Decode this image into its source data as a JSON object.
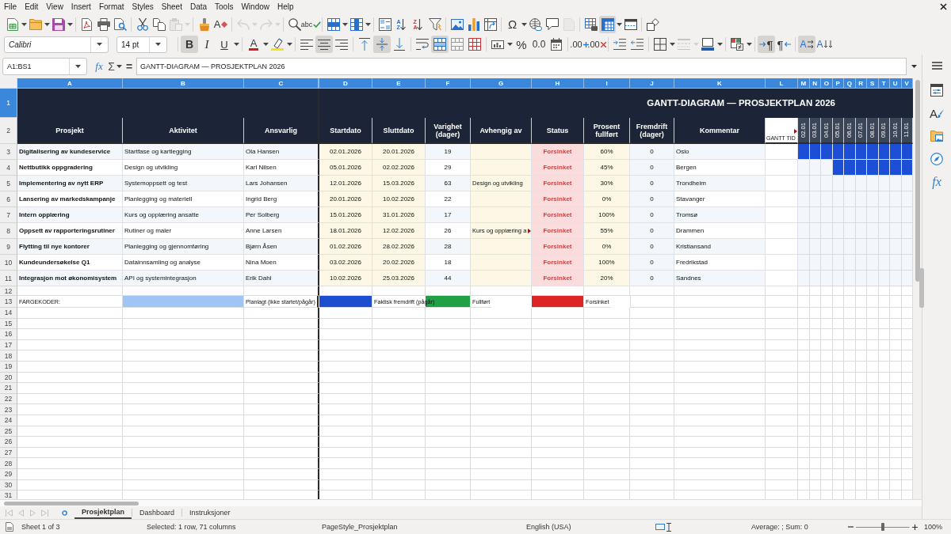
{
  "menu_bar": [
    "File",
    "Edit",
    "View",
    "Insert",
    "Format",
    "Styles",
    "Sheet",
    "Data",
    "Tools",
    "Window",
    "Help"
  ],
  "toolbar_1": {
    "groups": [
      {
        "items": [
          {
            "kind": "new",
            "dropdown": true,
            "pressed": false,
            "disabled": false
          },
          {
            "kind": "open",
            "dropdown": true,
            "pressed": false,
            "disabled": false
          },
          {
            "kind": "save",
            "dropdown": true,
            "pressed": false,
            "disabled": false
          }
        ]
      },
      {
        "items": [
          {
            "kind": "export_pdf",
            "pressed": false,
            "disabled": false
          },
          {
            "kind": "print",
            "pressed": false,
            "disabled": false
          },
          {
            "kind": "print_preview",
            "pressed": false,
            "disabled": false
          }
        ]
      },
      {
        "items": [
          {
            "kind": "cut",
            "pressed": false,
            "disabled": false
          },
          {
            "kind": "copy",
            "pressed": false,
            "disabled": false
          },
          {
            "kind": "paste",
            "dropdown": true,
            "pressed": false,
            "disabled": true
          }
        ]
      },
      {
        "items": [
          {
            "kind": "clone",
            "pressed": false,
            "disabled": false
          },
          {
            "kind": "clear_format",
            "glyph": "A",
            "pressed": false,
            "disabled": false
          }
        ]
      },
      {
        "items": [
          {
            "kind": "undo",
            "dropdown": true,
            "pressed": false,
            "disabled": true
          },
          {
            "kind": "redo",
            "dropdown": true,
            "pressed": false,
            "disabled": true
          }
        ]
      },
      {
        "items": [
          {
            "kind": "find_replace",
            "pressed": false,
            "disabled": false
          },
          {
            "kind": "spelling",
            "glyph": "abc",
            "pressed": false,
            "disabled": false
          }
        ]
      },
      {
        "items": [
          {
            "kind": "row",
            "dropdown": true,
            "pressed": false,
            "disabled": false
          },
          {
            "kind": "column",
            "dropdown": true,
            "pressed": false,
            "disabled": false
          }
        ]
      },
      {
        "items": [
          {
            "kind": "sort",
            "pressed": false,
            "disabled": false
          },
          {
            "kind": "sort_ascending",
            "glyph": "AZ",
            "pressed": false,
            "disabled": false
          },
          {
            "kind": "sort_descending",
            "glyph": "ZA",
            "pressed": false,
            "disabled": false
          },
          {
            "kind": "autofilter",
            "pressed": false,
            "disabled": false
          }
        ]
      },
      {
        "items": [
          {
            "kind": "image",
            "pressed": false,
            "disabled": false
          },
          {
            "kind": "chart",
            "pressed": false,
            "disabled": false
          },
          {
            "kind": "pivot_table",
            "pressed": false,
            "disabled": false
          }
        ]
      },
      {
        "items": [
          {
            "kind": "special_character",
            "glyph": "Ω",
            "dropdown": true,
            "pressed": false,
            "disabled": false
          },
          {
            "kind": "hyperlink",
            "pressed": false,
            "disabled": false
          },
          {
            "kind": "comment",
            "pressed": false,
            "disabled": false
          },
          {
            "kind": "header_footer",
            "pressed": false,
            "disabled": true
          }
        ]
      },
      {
        "items": [
          {
            "kind": "print_area",
            "pressed": false,
            "disabled": false
          },
          {
            "kind": "freeze",
            "dropdown": true,
            "pressed": true,
            "disabled": false
          },
          {
            "kind": "split_window",
            "pressed": false,
            "disabled": false
          }
        ]
      },
      {
        "items": [
          {
            "kind": "draw_functions",
            "pressed": false,
            "disabled": false
          }
        ]
      }
    ]
  },
  "toolbar_2": {
    "font_name": "Calibri",
    "font_size": "14 pt",
    "groups": [
      {
        "items": [
          {
            "kind": "bold",
            "glyph": "B",
            "pressed": true,
            "disabled": false
          },
          {
            "kind": "italic",
            "glyph": "I",
            "pressed": false,
            "disabled": false
          },
          {
            "kind": "underline",
            "glyph": "U",
            "dropdown": true,
            "pressed": false,
            "disabled": false
          }
        ]
      },
      {
        "items": [
          {
            "kind": "font_color",
            "glyph": "A",
            "dropdown": true,
            "pressed": false,
            "disabled": false
          },
          {
            "kind": "highlight",
            "dropdown": true,
            "pressed": false,
            "disabled": false
          }
        ]
      },
      {
        "items": [
          {
            "kind": "align_left",
            "pressed": false,
            "disabled": false
          },
          {
            "kind": "align_center",
            "pressed": true,
            "disabled": false
          },
          {
            "kind": "align_right",
            "pressed": false,
            "disabled": false
          }
        ]
      },
      {
        "items": [
          {
            "kind": "align_top",
            "pressed": false,
            "disabled": false
          },
          {
            "kind": "align_middle",
            "pressed": true,
            "disabled": false
          },
          {
            "kind": "align_bottom",
            "pressed": false,
            "disabled": false
          }
        ]
      },
      {
        "items": [
          {
            "kind": "wrap_text",
            "pressed": false,
            "disabled": false
          },
          {
            "kind": "merge_center",
            "pressed": true,
            "disabled": false
          },
          {
            "kind": "merge",
            "pressed": false,
            "disabled": false
          },
          {
            "kind": "unmerge",
            "pressed": false,
            "disabled": false
          }
        ]
      },
      {
        "items": [
          {
            "kind": "currency",
            "dropdown": true,
            "pressed": false,
            "disabled": false
          },
          {
            "kind": "percent",
            "glyph": "%",
            "pressed": false,
            "disabled": false
          },
          {
            "kind": "number",
            "glyph": "0.0",
            "pressed": false,
            "disabled": false
          },
          {
            "kind": "date",
            "pressed": false,
            "disabled": false
          }
        ]
      },
      {
        "items": [
          {
            "kind": "add_decimal",
            "glyph": ".00",
            "pressed": false,
            "disabled": false
          },
          {
            "kind": "delete_decimal",
            "glyph": ".00",
            "pressed": false,
            "disabled": false
          }
        ]
      },
      {
        "items": [
          {
            "kind": "indent_increase",
            "pressed": false,
            "disabled": false
          },
          {
            "kind": "indent_decrease",
            "pressed": false,
            "disabled": false
          }
        ]
      },
      {
        "items": [
          {
            "kind": "borders",
            "dropdown": true,
            "pressed": false,
            "disabled": false
          },
          {
            "kind": "border_style",
            "dropdown": true,
            "pressed": false,
            "disabled": true
          },
          {
            "kind": "border_color",
            "dropdown": true,
            "pressed": false,
            "disabled": false
          }
        ]
      },
      {
        "items": [
          {
            "kind": "conditional",
            "dropdown": true,
            "pressed": false,
            "disabled": false
          }
        ]
      },
      {
        "items": [
          {
            "kind": "left_to_right",
            "glyph": "¶",
            "pressed": true,
            "disabled": false
          },
          {
            "kind": "right_to_left",
            "glyph": "¶",
            "pressed": false,
            "disabled": false
          }
        ]
      },
      {
        "items": [
          {
            "kind": "text_horizontal",
            "glyph": "A",
            "pressed": true,
            "disabled": false
          },
          {
            "kind": "text_vertical",
            "glyph": "A",
            "pressed": false,
            "disabled": false
          }
        ]
      }
    ]
  },
  "formula_bar": {
    "name_box": "A1:BS1",
    "function_wizard": "fx",
    "sum": "Σ",
    "equals": "=",
    "content": "GANTT-DIAGRAM — PROSJEKTPLAN 2026"
  },
  "sidebar": {
    "items": [
      {
        "kind": "properties"
      },
      {
        "kind": "styles",
        "glyph": "A"
      },
      {
        "kind": "gallery"
      },
      {
        "kind": "navigator"
      },
      {
        "kind": "functions",
        "glyph": "fx"
      }
    ]
  },
  "sheet": {
    "column_headers": [
      {
        "label": "A",
        "selected": true
      },
      {
        "label": "B",
        "selected": true
      },
      {
        "label": "C",
        "selected": true
      },
      {
        "label": "D",
        "selected": true
      },
      {
        "label": "E",
        "selected": true
      },
      {
        "label": "F",
        "selected": true
      },
      {
        "label": "G",
        "selected": true
      },
      {
        "label": "H",
        "selected": true
      },
      {
        "label": "I",
        "selected": true
      },
      {
        "label": "J",
        "selected": true
      },
      {
        "label": "K",
        "selected": true
      },
      {
        "label": "L",
        "selected": true
      },
      {
        "label": "M",
        "selected": true
      },
      {
        "label": "N",
        "selected": true
      },
      {
        "label": "O",
        "selected": true
      },
      {
        "label": "P",
        "selected": true
      },
      {
        "label": "Q",
        "selected": true
      },
      {
        "label": "R",
        "selected": true
      },
      {
        "label": "S",
        "selected": true
      },
      {
        "label": "T",
        "selected": true
      },
      {
        "label": "U",
        "selected": true
      },
      {
        "label": "V",
        "selected": true
      }
    ],
    "row_headers": [
      {
        "label": "1",
        "selected": true
      },
      {
        "label": "2",
        "selected": false
      },
      {
        "label": "3",
        "selected": false
      },
      {
        "label": "4",
        "selected": false
      },
      {
        "label": "5",
        "selected": false
      },
      {
        "label": "6",
        "selected": false
      },
      {
        "label": "7",
        "selected": false
      },
      {
        "label": "8",
        "selected": false
      },
      {
        "label": "9",
        "selected": false
      },
      {
        "label": "10",
        "selected": false
      },
      {
        "label": "11",
        "selected": false
      },
      {
        "label": "12",
        "selected": false
      },
      {
        "label": "13",
        "selected": false
      },
      {
        "label": "14",
        "selected": false
      },
      {
        "label": "15",
        "selected": false
      },
      {
        "label": "16",
        "selected": false
      },
      {
        "label": "17",
        "selected": false
      },
      {
        "label": "18",
        "selected": false
      },
      {
        "label": "19",
        "selected": false
      },
      {
        "label": "20",
        "selected": false
      },
      {
        "label": "21",
        "selected": false
      },
      {
        "label": "22",
        "selected": false
      },
      {
        "label": "23",
        "selected": false
      },
      {
        "label": "24",
        "selected": false
      },
      {
        "label": "25",
        "selected": false
      },
      {
        "label": "26",
        "selected": false
      },
      {
        "label": "27",
        "selected": false
      },
      {
        "label": "28",
        "selected": false
      },
      {
        "label": "29",
        "selected": false
      },
      {
        "label": "30",
        "selected": false
      },
      {
        "label": "31",
        "selected": false
      }
    ],
    "title": "GANTT-DIAGRAM — PROSJEKTPLAN 2026",
    "headings": [
      "Prosjekt",
      "Aktivitet",
      "Ansvarlig",
      "Startdato",
      "Sluttdato",
      "Varighet (dager)",
      "Avhengig av",
      "Status",
      "Prosent fullført",
      "Fremdrift (dager)",
      "Kommentar"
    ],
    "gantt_heading": {
      "label": "GANTT TID",
      "clipped": true
    },
    "gantt_dates": [
      "02.01",
      "03.01",
      "04.01",
      "05.01",
      "06.01",
      "07.01",
      "08.01",
      "09.01",
      "10.01",
      "11.01"
    ],
    "rows": [
      {
        "project": "Digitalisering av kundeservice",
        "activity": "Startfase og kartlegging",
        "owner": "Ola Hansen",
        "start": "02.01.2026",
        "end": "20.01.2026",
        "duration": "19",
        "status": "Forsinket",
        "percent": "60%",
        "progress_days": "0",
        "comment": "Oslo",
        "gantt": [
          {
            "filled": true
          },
          {
            "filled": true
          },
          {
            "filled": true
          },
          {
            "filled": true
          },
          {
            "filled": true
          },
          {
            "filled": true
          },
          {
            "filled": true
          },
          {
            "filled": true
          },
          {
            "filled": true
          },
          {
            "filled": true
          }
        ]
      },
      {
        "project": "Nettbutikk oppgradering",
        "activity": "Design og utvikling",
        "owner": "Kari Nilsen",
        "start": "05.01.2026",
        "end": "02.02.2026",
        "duration": "29",
        "status": "Forsinket",
        "percent": "45%",
        "progress_days": "0",
        "comment": "Bergen",
        "gantt": [
          {
            "filled": false
          },
          {
            "filled": false
          },
          {
            "filled": false
          },
          {
            "filled": true
          },
          {
            "filled": true
          },
          {
            "filled": true
          },
          {
            "filled": true
          },
          {
            "filled": true
          },
          {
            "filled": true
          },
          {
            "filled": true
          }
        ]
      },
      {
        "project": "Implementering av nytt ERP",
        "activity": "Systemoppsett og test",
        "owner": "Lars Johansen",
        "start": "12.01.2026",
        "end": "15.03.2026",
        "duration": "63",
        "depends_on": {
          "text": "Design og utvikling",
          "clipped": false
        },
        "status": "Forsinket",
        "percent": "30%",
        "progress_days": "0",
        "comment": "Trondheim",
        "gantt": [
          {
            "filled": false
          },
          {
            "filled": false
          },
          {
            "filled": false
          },
          {
            "filled": false
          },
          {
            "filled": false
          },
          {
            "filled": false
          },
          {
            "filled": false
          },
          {
            "filled": false
          },
          {
            "filled": false
          },
          {
            "filled": false
          }
        ]
      },
      {
        "project": "Lansering av markedskampanje",
        "activity": "Planlegging og materiell",
        "owner": "Ingrid Berg",
        "start": "20.01.2026",
        "end": "10.02.2026",
        "duration": "22",
        "status": "Forsinket",
        "percent": "0%",
        "progress_days": "0",
        "comment": "Stavanger",
        "gantt": [
          {
            "filled": false
          },
          {
            "filled": false
          },
          {
            "filled": false
          },
          {
            "filled": false
          },
          {
            "filled": false
          },
          {
            "filled": false
          },
          {
            "filled": false
          },
          {
            "filled": false
          },
          {
            "filled": false
          },
          {
            "filled": false
          }
        ]
      },
      {
        "project": "Intern opplæring",
        "activity": "Kurs og opplæring ansatte",
        "owner": "Per Solberg",
        "start": "15.01.2026",
        "end": "31.01.2026",
        "duration": "17",
        "status": "Forsinket",
        "percent": "100%",
        "progress_days": "0",
        "comment": "Tromsø",
        "gantt": [
          {
            "filled": false
          },
          {
            "filled": false
          },
          {
            "filled": false
          },
          {
            "filled": false
          },
          {
            "filled": false
          },
          {
            "filled": false
          },
          {
            "filled": false
          },
          {
            "filled": false
          },
          {
            "filled": false
          },
          {
            "filled": false
          }
        ]
      },
      {
        "project": "Oppsett av rapporteringsrutiner",
        "activity": "Rutiner og maler",
        "owner": "Anne Larsen",
        "start": "18.01.2026",
        "end": "12.02.2026",
        "duration": "26",
        "depends_on": {
          "text": "Kurs og opplæring a",
          "clipped": true
        },
        "status": "Forsinket",
        "percent": "55%",
        "progress_days": "0",
        "comment": "Drammen",
        "gantt": [
          {
            "filled": false
          },
          {
            "filled": false
          },
          {
            "filled": false
          },
          {
            "filled": false
          },
          {
            "filled": false
          },
          {
            "filled": false
          },
          {
            "filled": false
          },
          {
            "filled": false
          },
          {
            "filled": false
          },
          {
            "filled": false
          }
        ]
      },
      {
        "project": "Flytting til nye kontorer",
        "activity": "Planlegging og gjennomføring",
        "owner": "Bjørn Åsen",
        "start": "01.02.2026",
        "end": "28.02.2026",
        "duration": "28",
        "status": "Forsinket",
        "percent": "0%",
        "progress_days": "0",
        "comment": "Kristiansand",
        "gantt": [
          {
            "filled": false
          },
          {
            "filled": false
          },
          {
            "filled": false
          },
          {
            "filled": false
          },
          {
            "filled": false
          },
          {
            "filled": false
          },
          {
            "filled": false
          },
          {
            "filled": false
          },
          {
            "filled": false
          },
          {
            "filled": false
          }
        ]
      },
      {
        "project": "Kundeundersøkelse Q1",
        "activity": "Datainnsamling og analyse",
        "owner": "Nina Moen",
        "start": "03.02.2026",
        "end": "20.02.2026",
        "duration": "18",
        "status": "Forsinket",
        "percent": "100%",
        "progress_days": "0",
        "comment": "Fredrikstad",
        "gantt": [
          {
            "filled": false
          },
          {
            "filled": false
          },
          {
            "filled": false
          },
          {
            "filled": false
          },
          {
            "filled": false
          },
          {
            "filled": false
          },
          {
            "filled": false
          },
          {
            "filled": false
          },
          {
            "filled": false
          },
          {
            "filled": false
          }
        ]
      },
      {
        "project": "Integrasjon mot økonomisystem",
        "activity": "API og systemintegrasjon",
        "owner": "Erik Dahl",
        "start": "10.02.2026",
        "end": "25.03.2026",
        "duration": "44",
        "status": "Forsinket",
        "percent": "20%",
        "progress_days": "0",
        "comment": "Sandnes",
        "gantt": [
          {
            "filled": false
          },
          {
            "filled": false
          },
          {
            "filled": false
          },
          {
            "filled": false
          },
          {
            "filled": false
          },
          {
            "filled": false
          },
          {
            "filled": false
          },
          {
            "filled": false
          },
          {
            "filled": false
          },
          {
            "filled": false
          }
        ]
      }
    ],
    "legend": {
      "title": "FARGEKODER:",
      "items": [
        {
          "color": "#9ec5f3",
          "label": "Planlagt (ikke startet/pågår)"
        },
        {
          "color": "#1d4ed0",
          "label": "Faktisk fremdrift (pågår)"
        },
        {
          "color": "#22a045",
          "label": "Fullført"
        },
        {
          "color": "#dc2626",
          "label": "Forsinket"
        }
      ]
    }
  },
  "sheet_tabs": {
    "navigation": [
      {
        "kind": "first",
        "disabled": true
      },
      {
        "kind": "previous",
        "disabled": true
      },
      {
        "kind": "next",
        "disabled": true
      },
      {
        "kind": "last",
        "disabled": true
      }
    ],
    "tabs": [
      {
        "label": "Prosjektplan",
        "selected": true
      },
      {
        "label": "Dashboard",
        "selected": false
      },
      {
        "label": "Instruksjoner",
        "selected": false
      }
    ]
  },
  "status_bar": {
    "sheet": "Sheet 1 of 3",
    "selection": "Selected: 1 row, 71 columns",
    "page_style": "PageStyle_Prosjektplan",
    "language": "English (USA)",
    "summary": "Average: ; Sum: 0",
    "zoom": {
      "level": 0.5,
      "reading": "100%"
    }
  }
}
